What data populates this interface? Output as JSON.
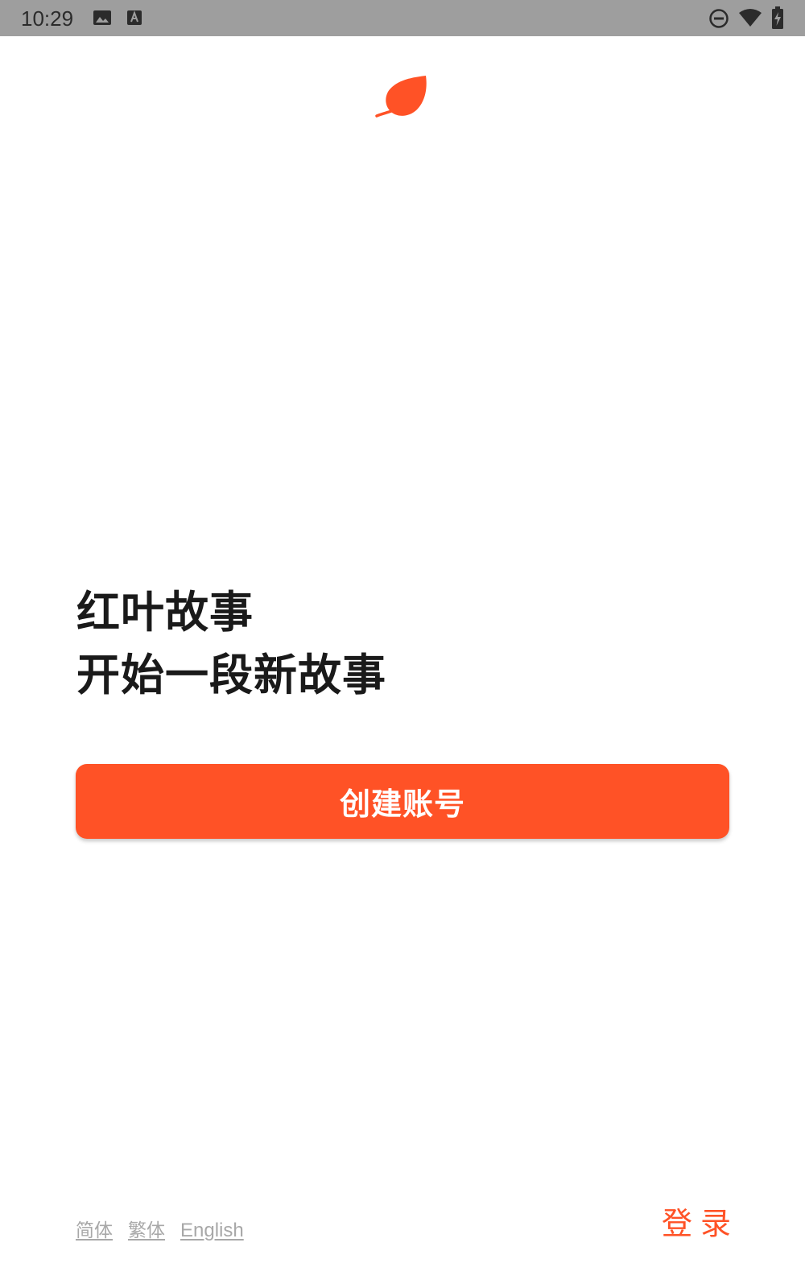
{
  "status_bar": {
    "time": "10:29",
    "left_icons": [
      "image-icon",
      "a-keyboard-icon"
    ],
    "right_icons": [
      "do-not-disturb-icon",
      "wifi-icon",
      "battery-charging-icon"
    ]
  },
  "brand": {
    "logo_icon": "leaf-icon",
    "accent_color": "#ff5226"
  },
  "hero": {
    "line1": "红叶故事",
    "line2": "开始一段新故事"
  },
  "create_account": {
    "label": "创建账号"
  },
  "languages": {
    "simplified": "简体",
    "traditional": "繁体",
    "english": "English"
  },
  "login": {
    "label": "登录"
  }
}
